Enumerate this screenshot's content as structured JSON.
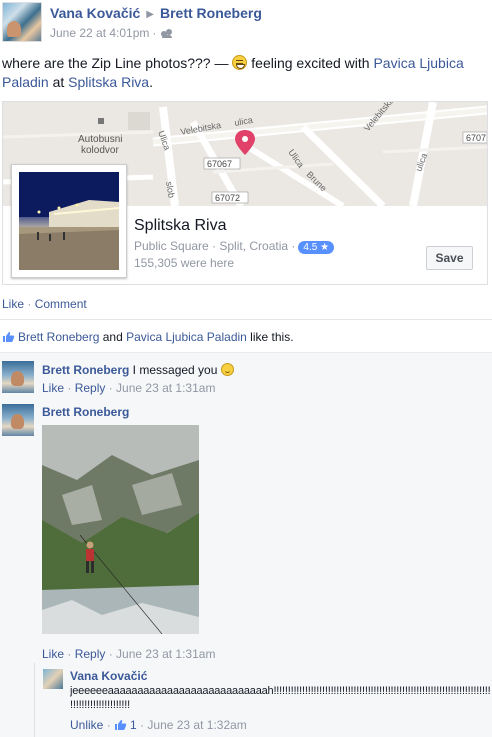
{
  "post": {
    "author": "Vana Kovačić",
    "arrow": "▶",
    "target": "Brett Roneberg",
    "date": "June 22 at 4:01pm",
    "dot": "·",
    "text_before": "where are the Zip Line photos??? — ",
    "feeling": "feeling excited with ",
    "tag1": "Pavica Ljubica Paladin",
    "at": " at ",
    "place_link": "Splitska Riva",
    "end": "."
  },
  "map": {
    "labels": [
      "Autobusni",
      "kolodvor",
      "Velebitska",
      "ulica",
      "Velebitska",
      "ulica",
      "Ulica",
      "Ulica",
      "Brune",
      "ulica",
      "slob",
      "67067",
      "67072",
      "6707"
    ]
  },
  "place": {
    "title": "Splitska Riva",
    "category": "Public Square · Split, Croatia ·",
    "rating": "4.5 ★",
    "visits": "155,305 were here",
    "save": "Save"
  },
  "actions": {
    "like": "Like",
    "sep": " · ",
    "comment": "Comment"
  },
  "likes": {
    "user1": "Brett Roneberg",
    "and": " and ",
    "user2": "Pavica Ljubica Paladin",
    "tail": " like this."
  },
  "comments": [
    {
      "name": "Brett Roneberg",
      "text": " I messaged you ",
      "like": "Like",
      "reply": "Reply",
      "time": "June 23 at 1:31am"
    },
    {
      "name": "Brett Roneberg",
      "like": "Like",
      "reply": "Reply",
      "time": "June 23 at 1:31am"
    }
  ],
  "reply": {
    "name": "Vana Kovačić",
    "text": "jeeeeeeaaaaaaaaaaaaaaaaaaaaaaaaaaah!!!!!!!!!!!!!!!!!!!!!!!!!!!!!!!!!!!!!!!!!!!!!!!!!!!!!!!!!!!!!!!!!!!!!!!!!!!!!!!!!!!!!!",
    "text2": "!!!!!!!!!!!!!!!!!!!!!",
    "unlike": "Unlike",
    "like_count": "1",
    "time": "June 23 at 1:32am"
  },
  "colors": {
    "link": "#3b5998",
    "grey": "#9197a3",
    "rating": "#5890ff",
    "pin": "#e0426a"
  }
}
